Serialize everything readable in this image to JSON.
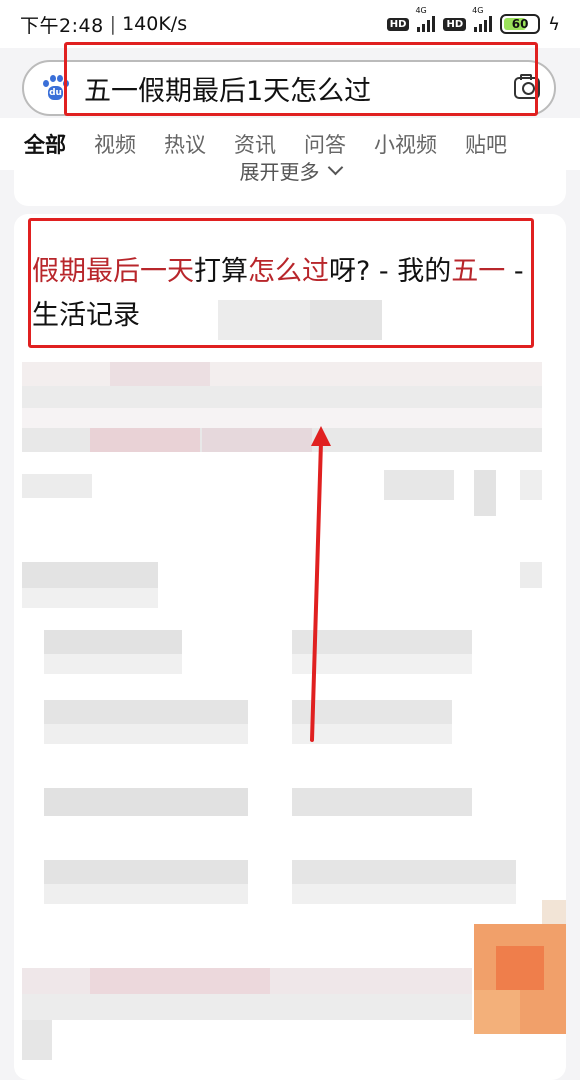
{
  "status_bar": {
    "time": "下午2:48",
    "speed": "140K/s",
    "hd_badge": "HD",
    "network": "4G",
    "battery": "60"
  },
  "search": {
    "query": "五一假期最后1天怎么过"
  },
  "tabs": [
    {
      "label": "全部",
      "active": true
    },
    {
      "label": "视频"
    },
    {
      "label": "热议"
    },
    {
      "label": "资讯"
    },
    {
      "label": "问答"
    },
    {
      "label": "小视频"
    },
    {
      "label": "贴吧"
    }
  ],
  "expand_more": "展开更多",
  "result": {
    "title_parts": [
      {
        "text": "假期最后一天",
        "highlight": true
      },
      {
        "text": "打算",
        "highlight": false
      },
      {
        "text": "怎么过",
        "highlight": true
      },
      {
        "text": "呀? - 我的",
        "highlight": false
      },
      {
        "text": "五一",
        "highlight": true
      },
      {
        "text": " - 生活记录",
        "highlight": false
      }
    ]
  },
  "colors": {
    "highlight": "#b8262b",
    "annotation_red": "#e02020",
    "tab_underline": "#3a5bd9"
  },
  "icons": {
    "logo": "baidu-paw-logo",
    "camera": "camera-icon",
    "expand": "chevron-down-icon",
    "charging": "bolt-icon"
  }
}
